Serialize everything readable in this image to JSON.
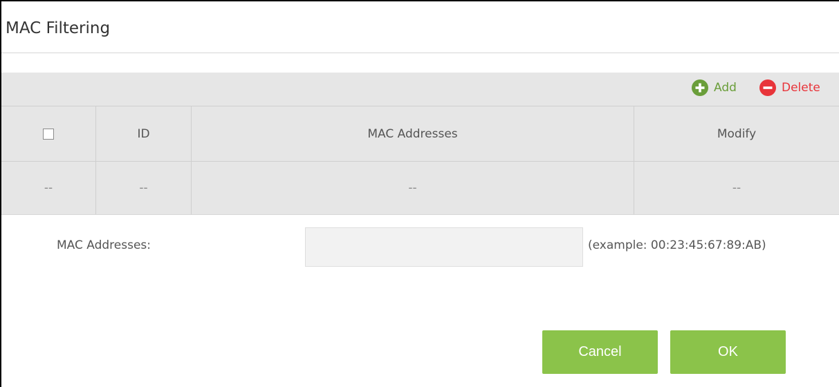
{
  "page": {
    "title": "MAC Filtering"
  },
  "toolbar": {
    "add_label": "Add",
    "add_icon": "plus-circle-icon",
    "add_color": "#6a9e3a",
    "delete_label": "Delete",
    "delete_icon": "minus-circle-icon",
    "delete_color": "#e8343a"
  },
  "table": {
    "columns": [
      "ID",
      "MAC Addresses",
      "Modify"
    ],
    "rows": [
      [
        "--",
        "--",
        "--",
        "--"
      ]
    ]
  },
  "form": {
    "mac_label": "MAC Addresses:",
    "mac_value": "",
    "mac_hint": "(example: 00:23:45:67:89:AB)"
  },
  "actions": {
    "cancel_label": "Cancel",
    "ok_label": "OK",
    "accent_color": "#8bc34a"
  }
}
